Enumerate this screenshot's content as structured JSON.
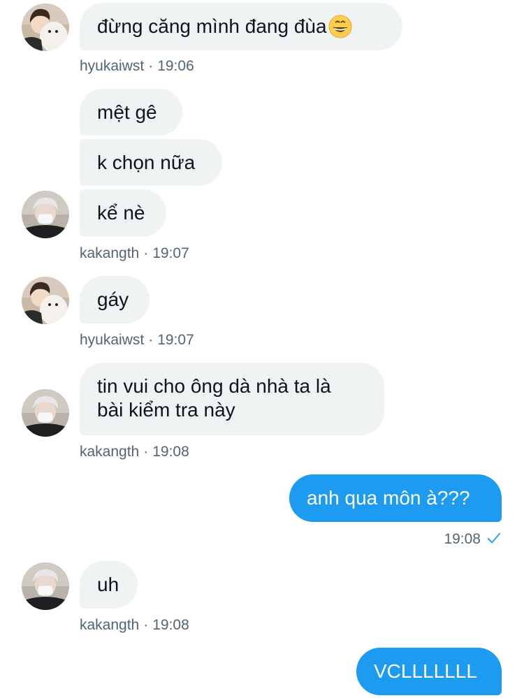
{
  "messages": [
    {
      "text": "đừng căng mình đang đùa",
      "emoji": "grinning-face"
    },
    {
      "text": "mệt gê"
    },
    {
      "text": "k chọn nữa"
    },
    {
      "text": "kể nè"
    },
    {
      "text": "gáy"
    },
    {
      "line1": "tin vui cho ông dà nhà ta là",
      "line2": "bài kiểm tra này"
    },
    {
      "text": "anh qua môn à???"
    },
    {
      "text": "uh"
    },
    {
      "text": "VCLLLLLLL"
    }
  ],
  "meta": [
    {
      "user": "hyukaiwst",
      "sep": "·",
      "time": "19:06"
    },
    {
      "user": "kakangth",
      "sep": "·",
      "time": "19:07"
    },
    {
      "user": "hyukaiwst",
      "sep": "·",
      "time": "19:07"
    },
    {
      "user": "kakangth",
      "sep": "·",
      "time": "19:08"
    },
    {
      "time": "19:08",
      "icon": "check-icon"
    },
    {
      "user": "kakangth",
      "sep": "·",
      "time": "19:08"
    }
  ],
  "colors": {
    "incoming_bubble": "#eff3f4",
    "outgoing_bubble": "#1d9bf0",
    "meta_text": "#536471",
    "text": "#0f1419"
  }
}
